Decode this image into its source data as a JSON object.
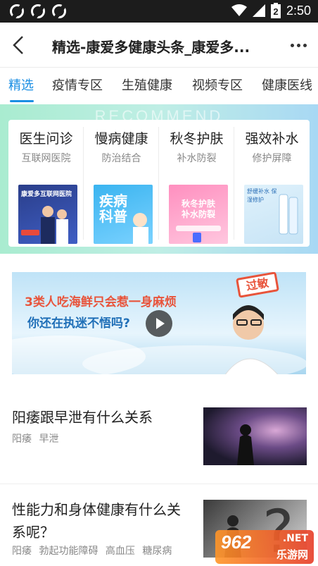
{
  "status_bar": {
    "time": "2:50",
    "battery_level": "2",
    "left_icons": [
      "sync-icon",
      "sync-icon",
      "sync-icon"
    ],
    "right_icons": [
      "wifi-icon",
      "signal-icon",
      "battery-icon"
    ]
  },
  "header": {
    "title": "精选-康爱多健康头条_康爱多..."
  },
  "tabs": [
    {
      "label": "精选",
      "active": true
    },
    {
      "label": "疫情专区",
      "active": false
    },
    {
      "label": "生殖健康",
      "active": false
    },
    {
      "label": "视频专区",
      "active": false
    },
    {
      "label": "健康医线",
      "active": false
    }
  ],
  "recommend": {
    "bg_text": "RECOMMEND",
    "cards": [
      {
        "title": "医生问诊",
        "subtitle": "互联网医院"
      },
      {
        "title": "慢病健康",
        "subtitle": "防治结合"
      },
      {
        "title": "秋冬护肤",
        "subtitle": "补水防裂"
      },
      {
        "title": "强效补水",
        "subtitle": "修护屏障"
      }
    ],
    "thumbs": {
      "t1": "康爱多互联网医院",
      "t2": "疾病科普",
      "t3": "秋冬护肤 补水防裂",
      "t4": "舒缓补水 保湿修护"
    }
  },
  "video": {
    "line1": "3类人吃海鲜只会惹一身麻烦",
    "line2": "你还在执迷不悟吗?",
    "badge": "过敏"
  },
  "articles": [
    {
      "title": "阳痿跟早泄有什么关系",
      "tags": [
        "阳痿",
        "早泄"
      ]
    },
    {
      "title": "性能力和身体健康有什么关系呢？",
      "tags": [
        "阳痿",
        "勃起功能障碍",
        "高血压",
        "糖尿病"
      ]
    }
  ],
  "watermark": {
    "number": "962",
    "net": ".NET",
    "text": "乐游网"
  },
  "colors": {
    "accent": "#1a8ee3",
    "status_bar": "#1c1c1c"
  }
}
